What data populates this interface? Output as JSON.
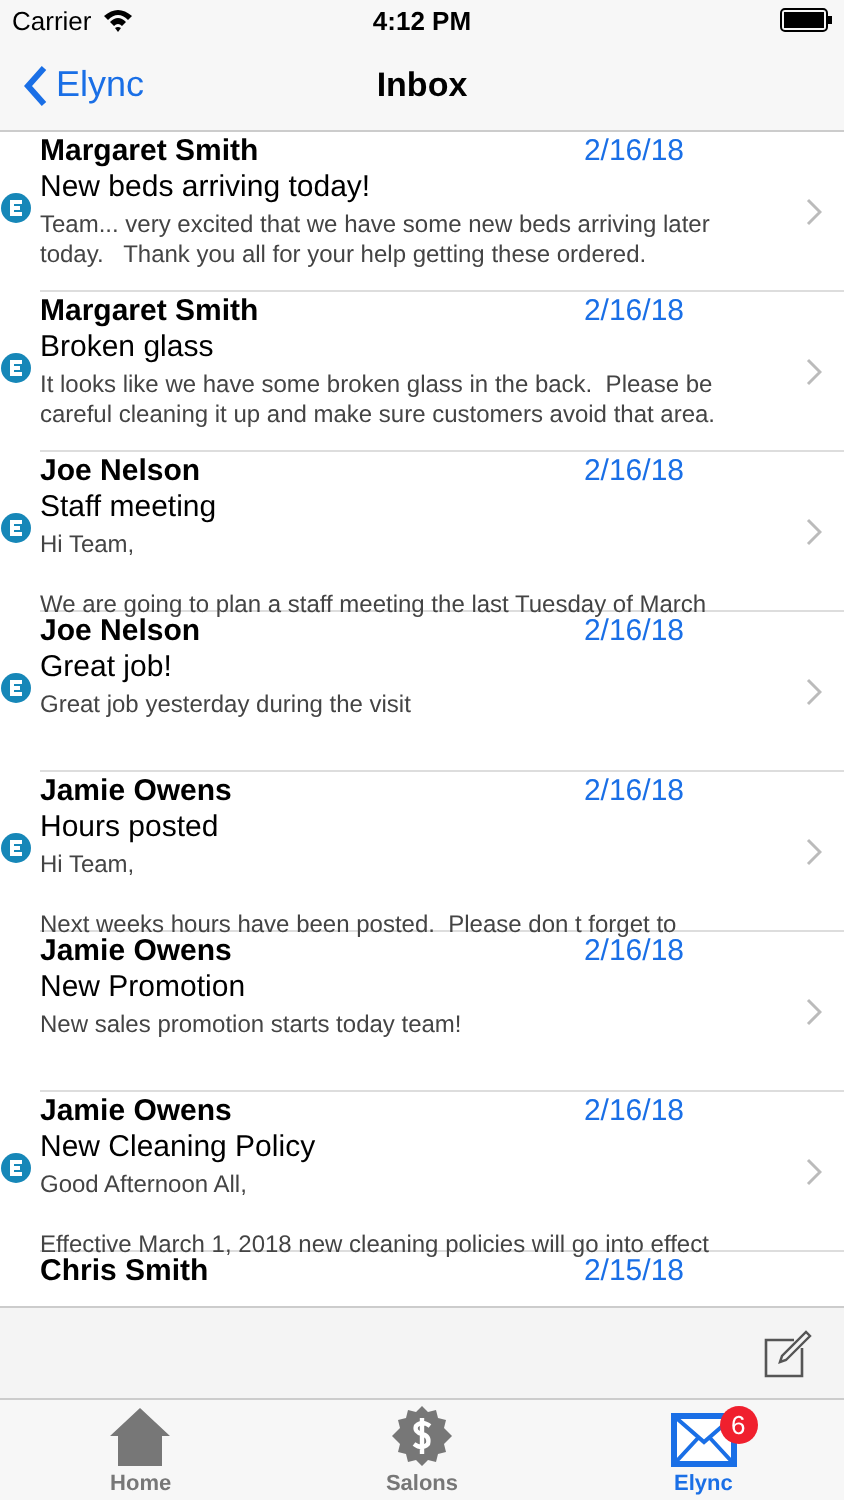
{
  "status_bar": {
    "carrier": "Carrier",
    "time": "4:12 PM"
  },
  "nav": {
    "back": "Elync",
    "title": "Inbox"
  },
  "messages": [
    {
      "sender": "Margaret Smith",
      "date": "2/16/18",
      "subject": "New beds arriving today!",
      "preview": "Team... very excited that we have some new beds arriving later\ntoday.   Thank you all for your help getting these ordered.",
      "unread": true
    },
    {
      "sender": "Margaret Smith",
      "date": "2/16/18",
      "subject": "Broken glass",
      "preview": "It looks like we have some broken glass in the back.  Please be\ncareful cleaning it up and make sure customers avoid that area.",
      "unread": true
    },
    {
      "sender": "Joe Nelson",
      "date": "2/16/18",
      "subject": "Staff meeting",
      "preview": "Hi Team,\n\nWe are going to plan a staff meeting the last Tuesday of March",
      "unread": true
    },
    {
      "sender": "Joe Nelson",
      "date": "2/16/18",
      "subject": "Great job!",
      "preview": "Great job yesterday during the visit",
      "unread": true
    },
    {
      "sender": "Jamie Owens",
      "date": "2/16/18",
      "subject": "Hours posted",
      "preview": "Hi Team,\n\nNext weeks hours have been posted.  Please don t forget to",
      "unread": true
    },
    {
      "sender": "Jamie Owens",
      "date": "2/16/18",
      "subject": "New Promotion",
      "preview": "New sales promotion starts today team!",
      "unread": false
    },
    {
      "sender": "Jamie Owens",
      "date": "2/16/18",
      "subject": "New Cleaning Policy",
      "preview": "Good Afternoon All,\n\nEffective March 1, 2018 new cleaning policies will go into effect",
      "unread": true
    },
    {
      "sender": "Chris Smith",
      "date": "2/15/18"
    }
  ],
  "tabs": [
    {
      "label": "Home",
      "kind": "home",
      "selected": false
    },
    {
      "label": "Salons",
      "kind": "salons",
      "selected": false
    },
    {
      "label": "Elync",
      "kind": "mail",
      "selected": true,
      "badge": "6"
    }
  ]
}
